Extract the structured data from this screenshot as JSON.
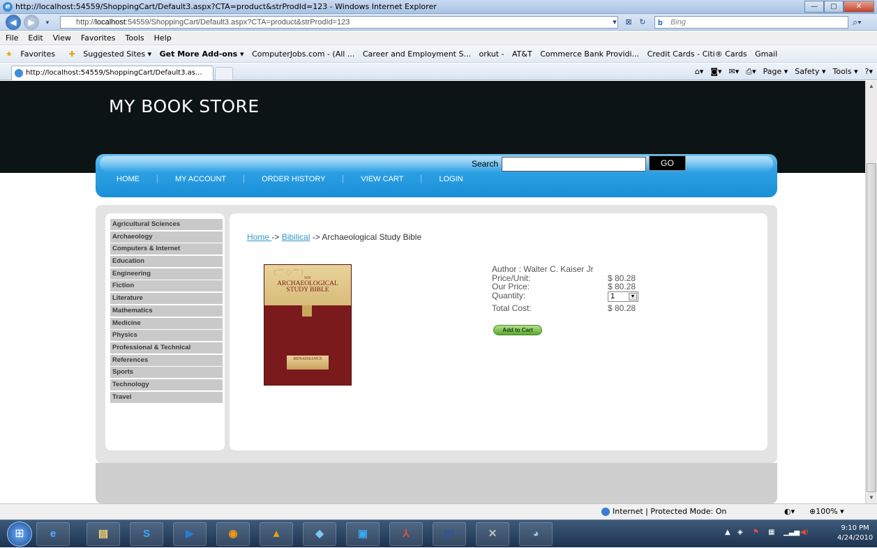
{
  "window": {
    "title": "http://localhost:54559/ShoppingCart/Default3.aspx?CTA=product&strProdId=123 - Windows Internet Explorer",
    "minimize_icon": "minimize-icon",
    "maximize_icon": "maximize-icon",
    "close_icon": "close-icon"
  },
  "addressbar": {
    "url_prefix": "http://",
    "url_host": "localhost",
    "url_rest": ":54559/ShoppingCart/Default3.aspx?CTA=product&strProdId=123",
    "search_placeholder": "Bing",
    "search_engine_logo": "b"
  },
  "menubar": [
    "File",
    "Edit",
    "View",
    "Favorites",
    "Tools",
    "Help"
  ],
  "favorites": {
    "label": "Favorites",
    "items": [
      "Suggested Sites ▾",
      "Get More Add-ons ▾",
      "ComputerJobs.com - (All ...",
      "Career and Employment S...",
      "orkut -",
      "AT&T",
      "Commerce Bank  Providi...",
      "Credit Cards - Citi® Cards",
      "Gmail"
    ]
  },
  "tab": {
    "label": "http://localhost:54559/ShoppingCart/Default3.as..."
  },
  "commandbar": [
    "Page ▾",
    "Safety ▾",
    "Tools ▾"
  ],
  "store": {
    "title": "MY BOOK STORE",
    "nav": [
      "HOME",
      "MY ACCOUNT",
      "ORDER HISTORY",
      "VIEW CART",
      "LOGIN"
    ],
    "search_label": "Search",
    "search_value": "",
    "go_label": "GO"
  },
  "categories": [
    "Agricultural Sciences",
    "Archaeology",
    "Computers & Internet",
    "Education",
    "Engineering",
    "Fiction",
    "Literature",
    "Mathematics",
    "Medicine",
    "Physics",
    "Professional & Technical",
    "References",
    "Sports",
    "Technology",
    "Travel"
  ],
  "breadcrumb": {
    "home": "Home ",
    "sep1": "-> ",
    "category": "Bibilical",
    "sep2": " -> ",
    "current": "Archaeological Study Bible"
  },
  "book_cover": {
    "ornament": "〔⌒◇⌒〕",
    "imprint": "NIV",
    "title_line1": "ARCHAEOLOGICAL",
    "title_line2": "STUDY BIBLE",
    "badge": "RENAISSANCE"
  },
  "product": {
    "author": "Author : Walter C. Kaiser Jr",
    "price_unit_label": "Price/Unit:",
    "price_unit": "$ 80.28",
    "our_price_label": "Our Price:",
    "our_price": "$ 80.28",
    "quantity_label": "Quantity:",
    "quantity": "1",
    "total_label": "Total Cost:",
    "total": "$ 80.28",
    "add_to_cart": "Add to Cart"
  },
  "statusbar": {
    "zone": "Internet | Protected Mode: On",
    "zoom": "100%"
  },
  "taskbar": {
    "time": "9:10 PM",
    "date": "4/24/2010"
  }
}
